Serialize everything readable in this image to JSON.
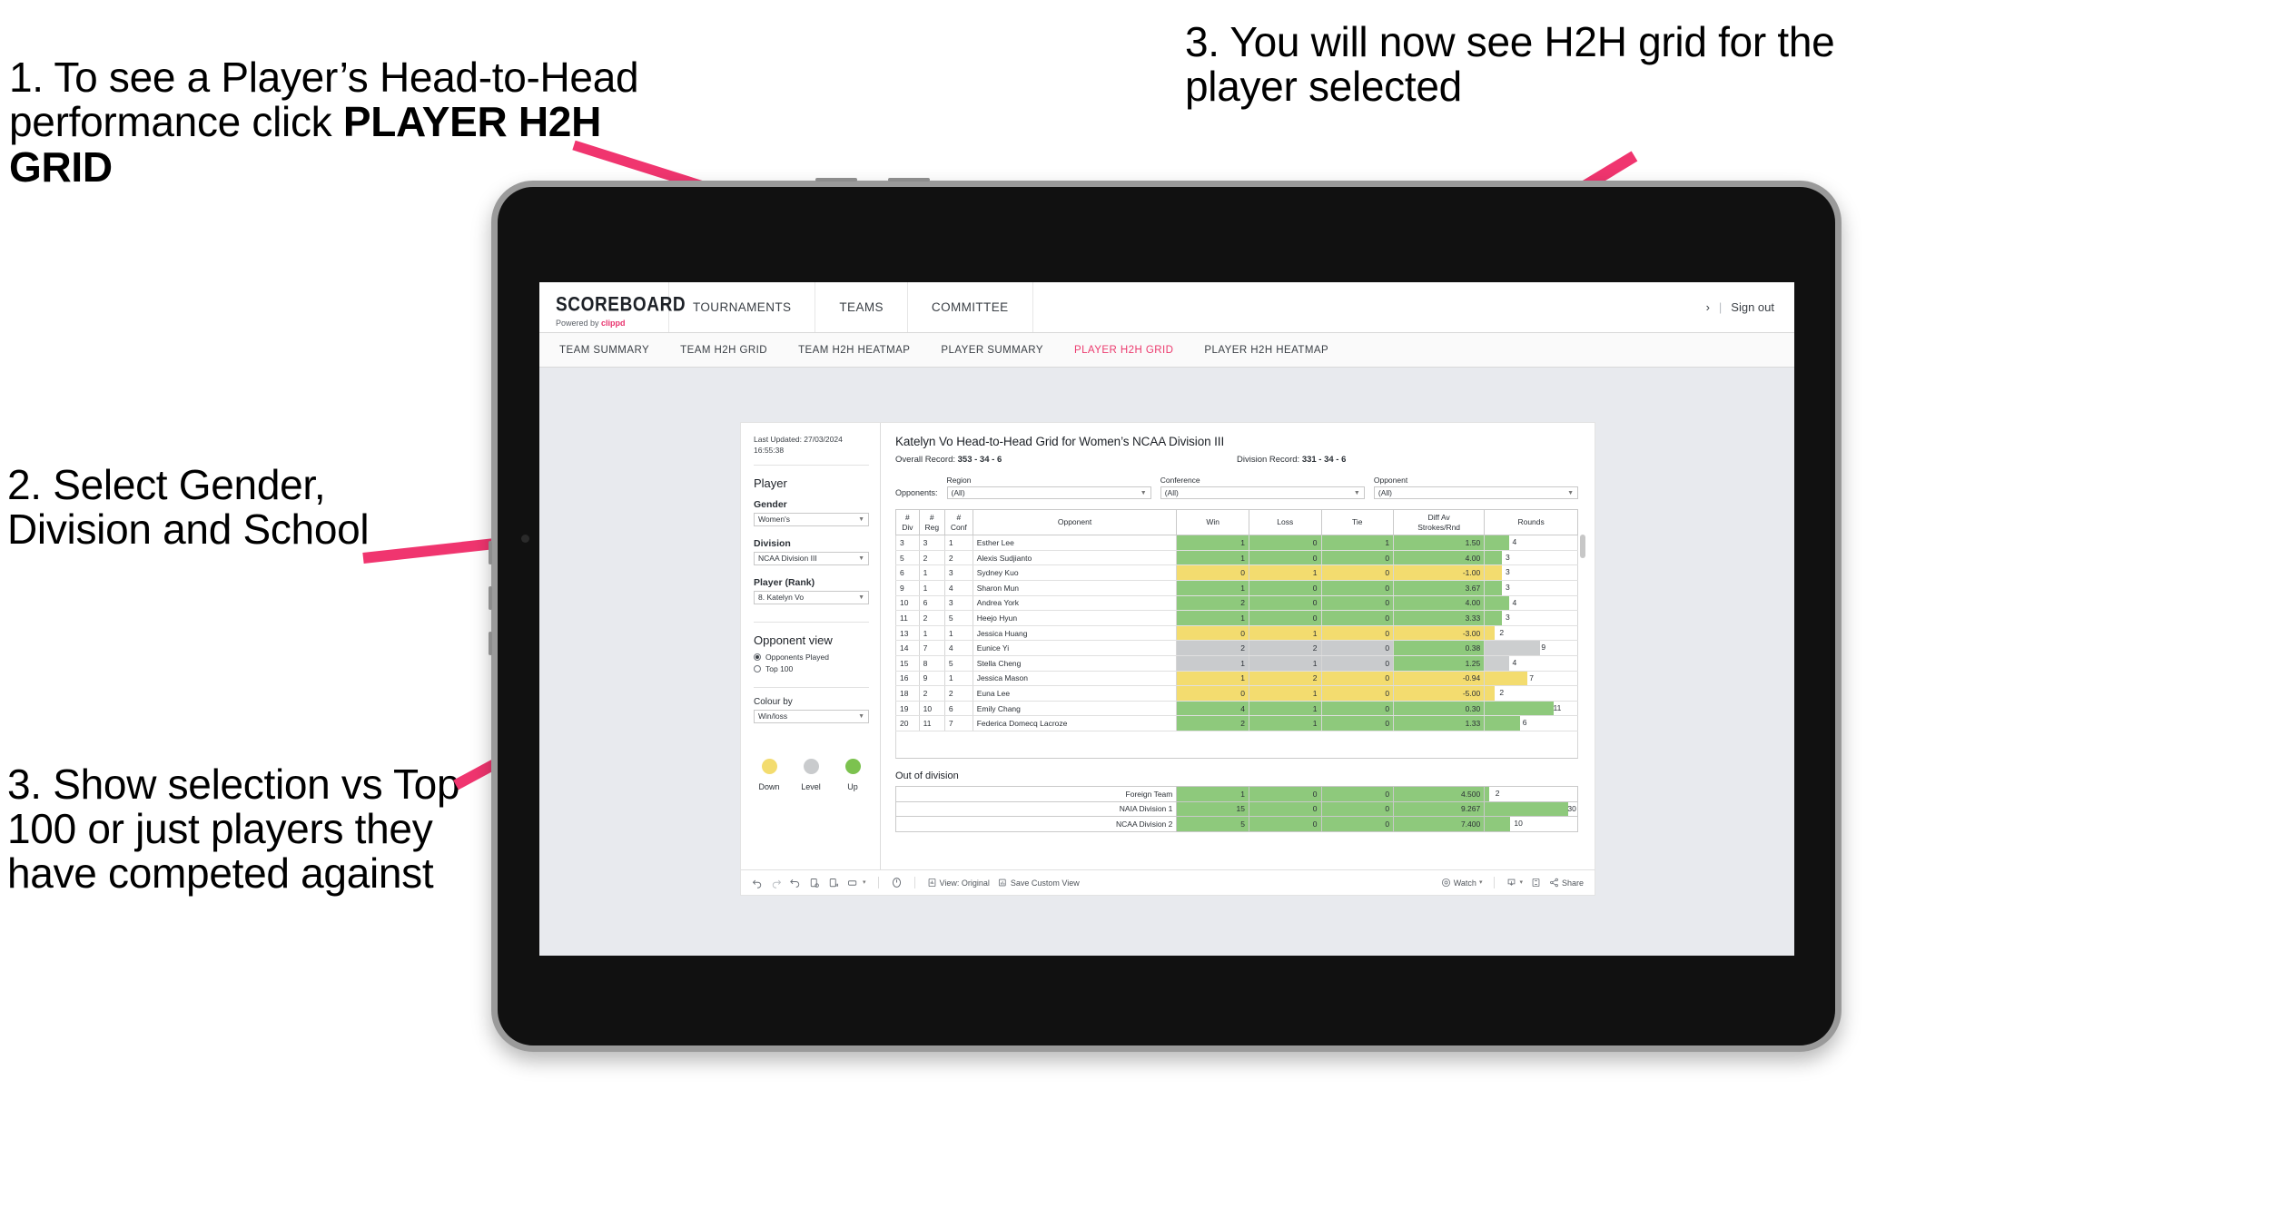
{
  "annotations": [
    {
      "id": "anno-1",
      "text": "1. To see a Player’s Head-to-Head performance click ",
      "bold_text": "PLAYER H2H GRID"
    },
    {
      "id": "anno-2",
      "text": "2. Select Gender, Division and School"
    },
    {
      "id": "anno-3",
      "text": "3. Show selection vs Top 100 or just players they have competed against"
    },
    {
      "id": "anno-4",
      "text": "3. You will now see H2H grid for the player selected"
    }
  ],
  "colors": {
    "accent_pink": "#ec3a6e",
    "arrow_pink": "#f0356f",
    "win_green": "#8ec97c",
    "loss_yellow": "#f3dc6f",
    "level_grey": "#c9cbcd",
    "bar_green": "#8ec97c",
    "bar_yellow": "#f3dc6f",
    "bar_grey": "#cccecf"
  },
  "app": {
    "logo": {
      "word": "SCOREBOARD",
      "powered_prefix": "Powered by ",
      "brand": "clippd"
    },
    "topnav": [
      "TOURNAMENTS",
      "TEAMS",
      "COMMITTEE"
    ],
    "topnav_right": {
      "chevron": "›",
      "separator": "|",
      "signout": "Sign out"
    },
    "subtabs": [
      {
        "label": "TEAM SUMMARY",
        "active": false
      },
      {
        "label": "TEAM H2H GRID",
        "active": false
      },
      {
        "label": "TEAM H2H HEATMAP",
        "active": false
      },
      {
        "label": "PLAYER SUMMARY",
        "active": false
      },
      {
        "label": "PLAYER H2H GRID",
        "active": true
      },
      {
        "label": "PLAYER H2H HEATMAP",
        "active": false
      }
    ]
  },
  "panel": {
    "last_updated": "Last Updated: 27/03/2024\n16:55:38",
    "heading": "Player",
    "fields": [
      {
        "label": "Gender",
        "value": "Women's"
      },
      {
        "label": "Division",
        "value": "NCAA Division III"
      },
      {
        "label": "Player (Rank)",
        "value": "8. Katelyn Vo"
      }
    ],
    "opponent_view": {
      "heading": "Opponent view",
      "options": [
        {
          "label": "Opponents Played",
          "selected": true
        },
        {
          "label": "Top 100",
          "selected": false
        }
      ]
    },
    "colour_by": {
      "label": "Colour by",
      "value": "Win/loss"
    },
    "legend": [
      {
        "label": "Down",
        "color": "#f3dc6f"
      },
      {
        "label": "Level",
        "color": "#c9cbcd"
      },
      {
        "label": "Up",
        "color": "#8ec97c"
      }
    ]
  },
  "main": {
    "title": "Katelyn Vo Head-to-Head Grid for Women’s NCAA Division III",
    "overall_record_label": "Overall Record: ",
    "overall_record_value": "353 -  34 - 6",
    "division_record_label": "Division Record: ",
    "division_record_value": "331 -  34 - 6",
    "opponents_label": "Opponents:",
    "filters": [
      {
        "label": "Region",
        "value": "(All)"
      },
      {
        "label": "Conference",
        "value": "(All)"
      },
      {
        "label": "Opponent",
        "value": "(All)"
      }
    ],
    "columns": [
      "#\nDiv",
      "#\nReg",
      "#\nConf",
      "Opponent",
      "Win",
      "Loss",
      "Tie",
      "Diff Av\nStrokes/Rnd",
      "Rounds"
    ],
    "rows": [
      {
        "div": "3",
        "reg": "3",
        "conf": "1",
        "opponent": "Esther Lee",
        "win": "1",
        "loss": "0",
        "tie": "1",
        "diff": "1.50",
        "rounds": "4",
        "color": "green",
        "bar_pct": 26
      },
      {
        "div": "5",
        "reg": "2",
        "conf": "2",
        "opponent": "Alexis Sudjianto",
        "win": "1",
        "loss": "0",
        "tie": "0",
        "diff": "4.00",
        "rounds": "3",
        "color": "green",
        "bar_pct": 18
      },
      {
        "div": "6",
        "reg": "1",
        "conf": "3",
        "opponent": "Sydney Kuo",
        "win": "0",
        "loss": "1",
        "tie": "0",
        "diff": "-1.00",
        "rounds": "3",
        "color": "yellow",
        "bar_pct": 18
      },
      {
        "div": "9",
        "reg": "1",
        "conf": "4",
        "opponent": "Sharon Mun",
        "win": "1",
        "loss": "0",
        "tie": "0",
        "diff": "3.67",
        "rounds": "3",
        "color": "green",
        "bar_pct": 18
      },
      {
        "div": "10",
        "reg": "6",
        "conf": "3",
        "opponent": "Andrea York",
        "win": "2",
        "loss": "0",
        "tie": "0",
        "diff": "4.00",
        "rounds": "4",
        "color": "green",
        "bar_pct": 26
      },
      {
        "div": "11",
        "reg": "2",
        "conf": "5",
        "opponent": "Heejo Hyun",
        "win": "1",
        "loss": "0",
        "tie": "0",
        "diff": "3.33",
        "rounds": "3",
        "color": "green",
        "bar_pct": 18
      },
      {
        "div": "13",
        "reg": "1",
        "conf": "1",
        "opponent": "Jessica Huang",
        "win": "0",
        "loss": "1",
        "tie": "0",
        "diff": "-3.00",
        "rounds": "2",
        "color": "yellow",
        "bar_pct": 11
      },
      {
        "div": "14",
        "reg": "7",
        "conf": "4",
        "opponent": "Eunice Yi",
        "win": "2",
        "loss": "2",
        "tie": "0",
        "diff": "0.38",
        "rounds": "9",
        "color": "grey",
        "bar_pct": 60,
        "diff_color": "green"
      },
      {
        "div": "15",
        "reg": "8",
        "conf": "5",
        "opponent": "Stella Cheng",
        "win": "1",
        "loss": "1",
        "tie": "0",
        "diff": "1.25",
        "rounds": "4",
        "color": "grey",
        "bar_pct": 26,
        "diff_color": "green"
      },
      {
        "div": "16",
        "reg": "9",
        "conf": "1",
        "opponent": "Jessica Mason",
        "win": "1",
        "loss": "2",
        "tie": "0",
        "diff": "-0.94",
        "rounds": "7",
        "color": "yellow",
        "bar_pct": 46
      },
      {
        "div": "18",
        "reg": "2",
        "conf": "2",
        "opponent": "Euna Lee",
        "win": "0",
        "loss": "1",
        "tie": "0",
        "diff": "-5.00",
        "rounds": "2",
        "color": "yellow",
        "bar_pct": 11
      },
      {
        "div": "19",
        "reg": "10",
        "conf": "6",
        "opponent": "Emily Chang",
        "win": "4",
        "loss": "1",
        "tie": "0",
        "diff": "0.30",
        "rounds": "11",
        "color": "green",
        "bar_pct": 74
      },
      {
        "div": "20",
        "reg": "11",
        "conf": "7",
        "opponent": "Federica Domecq Lacroze",
        "win": "2",
        "loss": "1",
        "tie": "0",
        "diff": "1.33",
        "rounds": "6",
        "color": "green",
        "bar_pct": 38
      }
    ],
    "out_of_division": {
      "title": "Out of division",
      "rows": [
        {
          "name": "Foreign Team",
          "win": "1",
          "loss": "0",
          "tie": "0",
          "diff": "4.500",
          "rounds": "2",
          "color": "green",
          "bar_pct": 5
        },
        {
          "name": "NAIA Division 1",
          "win": "15",
          "loss": "0",
          "tie": "0",
          "diff": "9.267",
          "rounds": "30",
          "color": "green",
          "bar_pct": 90
        },
        {
          "name": "NCAA Division 2",
          "win": "5",
          "loss": "0",
          "tie": "0",
          "diff": "7.400",
          "rounds": "10",
          "color": "green",
          "bar_pct": 27
        }
      ]
    }
  },
  "toolbar": {
    "view_label": "View: Original",
    "save_label": "Save Custom View",
    "watch_label": "Watch",
    "share_label": "Share",
    "caret": "▾"
  }
}
